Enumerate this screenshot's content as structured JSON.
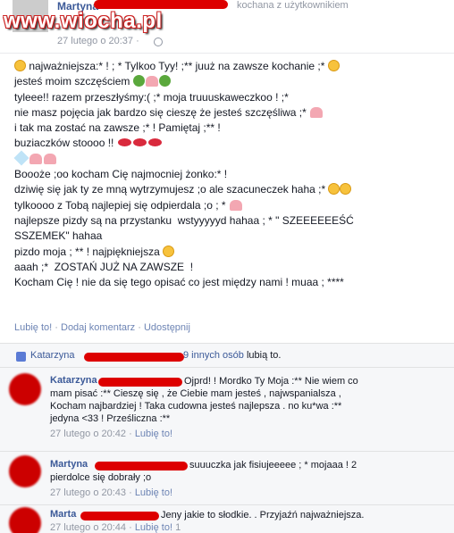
{
  "watermark": "www.wiocha.pl",
  "post": {
    "author": "Martyna",
    "status_suffix": "kochana z użytkownikiem",
    "timestamp": "27 lutego o 20:37 ·",
    "lines": [
      " najważniejsza:* ! ; * Tylkoo Tyy! ;** juuż na zawsze kochanie ;* ",
      "jesteś moim szczęściem ",
      "tyleee!! razem przeszłyśmy:( ;* moja truuuskaweczkoo ! ;*",
      "nie masz pojęcia jak bardzo się cieszę że jesteś szczęśliwa ;* ",
      "i tak ma zostać na zawsze ;* ! Pamiętaj ;** !",
      "buziaczków stoooo !! ",
      "",
      "Boooże ;oo kocham Cię najmocniej żonko:* !",
      "dziwię się jak ty ze mną wytrzymujesz ;o ale szacuneczek haha ;* ",
      "tylkoooo z Tobą najlepiej się odpierdala ;o ; * ",
      "najlepsze pizdy są na przystanku  wstyyyyyd hahaa ; * \" SZEEEEEEŚĆ",
      "SSZEMEK\" hahaa",
      "pizdo moja ; ** ! najpiękniejsza ",
      "aaah ;*  ZOSTAŃ JUŻ NA ZAWSZE  ! ",
      "Kocham Cię ! nie da się tego opisać co jest między nami ! muaa ; ****"
    ],
    "actions": [
      "Lubię to!",
      "Dodaj komentarz",
      "Udostępnij"
    ]
  },
  "likes": {
    "first_name": "Katarzyna",
    "others": "9 innych osób",
    "suffix": "lubią to."
  },
  "comments": [
    {
      "name": "Katarzyna",
      "text1": "Ojprd!  ! Mordko Ty Moja :** Nie wiem co",
      "text2": "mam pisać :** Cieszę się , że Ciebie mam  jesteś , najwspanialsza ,",
      "text3": "Kocham najbardziej  ! Taka cudowna  jesteś najlepsza . no ku*wa :**",
      "text4": "jedyna <33 ! Prześliczna :**",
      "time": "27 lutego o 20:42 ·",
      "like": "Lubię to!"
    },
    {
      "name": "Martyna",
      "text1": "suuuczka jak fisiujeeeee ; * mojaaa !  2",
      "text2": "pierdolce się dobrały ;o ",
      "time": "27 lutego o 20:43 ·",
      "like": "Lubię to!"
    },
    {
      "name": "Marta",
      "text1": "Jeny jakie to słodkie.  . Przyjaźń najważniejsza. ",
      "time": "27 lutego o 20:44 ·",
      "like": "Lubię to!",
      "like_count": "1"
    }
  ],
  "colors": {
    "link": "#3b5998",
    "meta": "#9197a3",
    "redact": "#d00"
  }
}
